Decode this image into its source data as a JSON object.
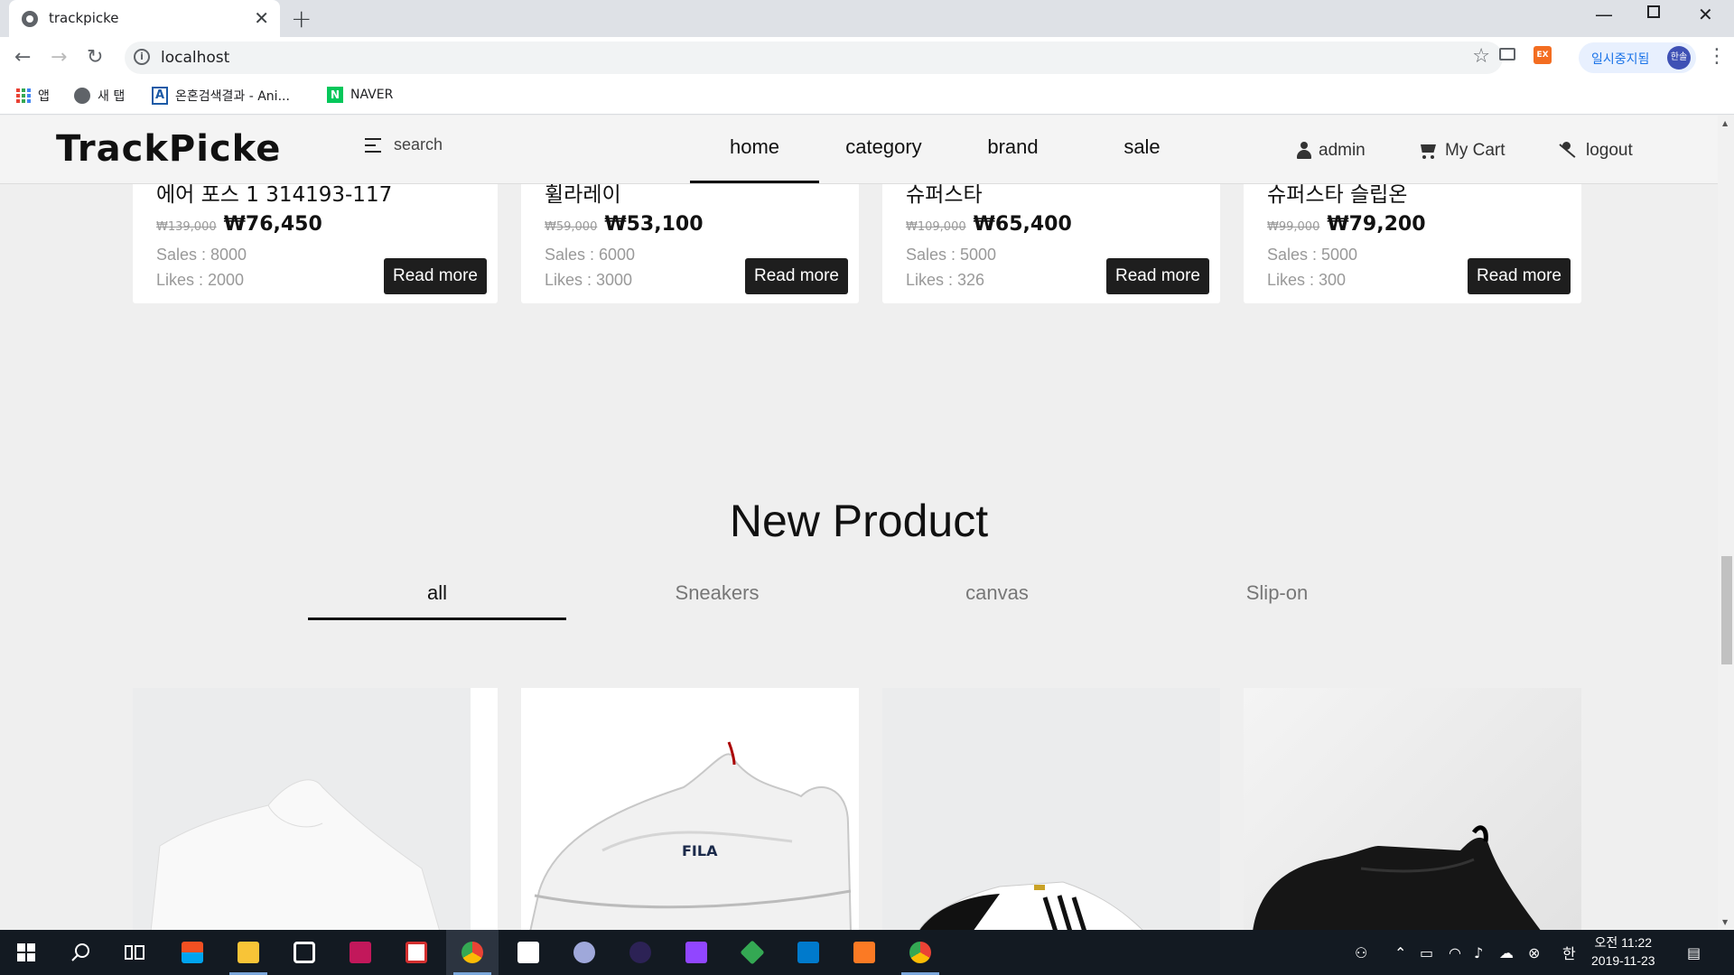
{
  "browser": {
    "tab_title": "trackpicke",
    "url": "localhost",
    "profile_label": "일시중지됨",
    "profile_avatar": "한솔",
    "ext_badge": "EX",
    "bookmarks": [
      {
        "label": "앱"
      },
      {
        "label": "새 탭"
      },
      {
        "label": "온혼검색결과 - Ani..."
      },
      {
        "label": "NAVER"
      }
    ]
  },
  "header": {
    "logo": "TrackPicke",
    "search_placeholder": "search",
    "nav": [
      {
        "label": "home",
        "active": true
      },
      {
        "label": "category"
      },
      {
        "label": "brand"
      },
      {
        "label": "sale"
      }
    ],
    "user": "admin",
    "cart": "My Cart",
    "logout": "logout"
  },
  "top_products": [
    {
      "name": "에어 포스 1 314193-117",
      "old_price": "₩139,000",
      "price": "₩76,450",
      "sales": "Sales : 8000",
      "likes": "Likes : 2000",
      "button": "Read more"
    },
    {
      "name": "휠라레이",
      "old_price": "₩59,000",
      "price": "₩53,100",
      "sales": "Sales : 6000",
      "likes": "Likes : 3000",
      "button": "Read more"
    },
    {
      "name": "슈퍼스타",
      "old_price": "₩109,000",
      "price": "₩65,400",
      "sales": "Sales : 5000",
      "likes": "Likes : 326",
      "button": "Read more"
    },
    {
      "name": "슈퍼스타 슬립온",
      "old_price": "₩99,000",
      "price": "₩79,200",
      "sales": "Sales : 5000",
      "likes": "Likes : 300",
      "button": "Read more"
    }
  ],
  "new_product": {
    "title": "New Product",
    "tabs": [
      {
        "label": "all",
        "active": true
      },
      {
        "label": "Sneakers"
      },
      {
        "label": "canvas"
      },
      {
        "label": "Slip-on"
      }
    ]
  },
  "taskbar": {
    "ime": "한",
    "time_period": "오전 11:22",
    "date": "2019-11-23"
  }
}
